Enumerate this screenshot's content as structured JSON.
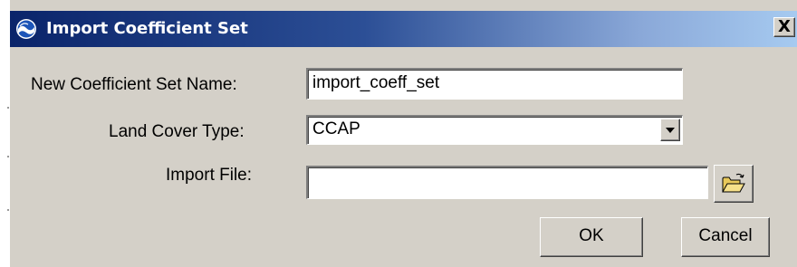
{
  "window": {
    "title": "Import Coefficient Set",
    "title_icon": "noaa-logo-icon",
    "close_glyph": "X"
  },
  "form": {
    "name_label": "New Coefficient Set Name:",
    "name_value": "import_coeff_set",
    "land_cover_label": "Land Cover Type:",
    "land_cover_value": "CCAP",
    "import_file_label": "Import File:",
    "import_file_value": "",
    "browse_icon": "open-folder-icon"
  },
  "buttons": {
    "ok_label": "OK",
    "cancel_label": "Cancel"
  },
  "colors": {
    "titlebar_start": "#0a246a",
    "titlebar_end": "#a6caf0",
    "dialog_face": "#d4d0c8"
  }
}
